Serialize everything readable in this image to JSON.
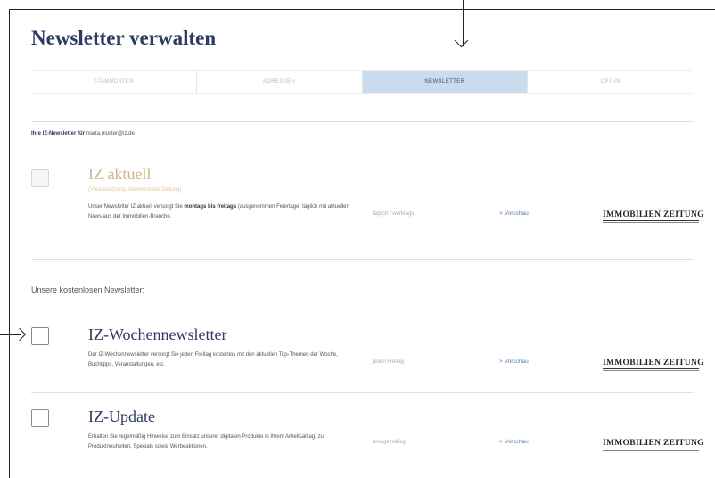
{
  "page": {
    "title": "Newsletter verwalten"
  },
  "tabs": [
    {
      "label": "STAMMDATEN",
      "active": false
    },
    {
      "label": "ADRESSEN",
      "active": false
    },
    {
      "label": "NEWSLETTER",
      "active": true
    },
    {
      "label": "OPT-IN",
      "active": false
    }
  ],
  "recipient": {
    "label": "Ihre IZ-Newsletter für",
    "email": "marta.muster@iz.de"
  },
  "section_free_label": "Unsere kostenlosen Newsletter:",
  "preview_label": "> Vorschau",
  "logo_text": "IMMOBILIEN ZEITUNG",
  "newsletters": [
    {
      "title": "IZ aktuell",
      "subtitle": "(Voraussetzung: Abonnent der Zeitung)",
      "desc_pre": "Unser Newsletter IZ aktuell versorgt Sie ",
      "desc_bold": "montags bis freitags",
      "desc_post": " (ausgenommen Feiertage) täglich mit aktuellen News aus der Immobilien-Branche.",
      "frequency": "täglich / werktags",
      "checked": false,
      "disabled": true
    },
    {
      "title": "IZ-Wochennewsletter",
      "desc": "Der IZ-Wochennewsletter versorgt Sie jeden Freitag kostenlos mit den aktuellen Top-Themen der Woche, Buchtipps, Veranstaltungen, etc.",
      "frequency": "jeden Freitag",
      "checked": false,
      "disabled": false
    },
    {
      "title": "IZ-Update",
      "desc": "Erhalten Sie regelmäßig Hinweise zum Einsatz unserer digitalen Produkte in Ihrem Arbeitsalltag, zu Produktneuheiten, Specials sowie Werbeaktionen.",
      "frequency": "unregelmäßig",
      "checked": false,
      "disabled": false
    }
  ]
}
